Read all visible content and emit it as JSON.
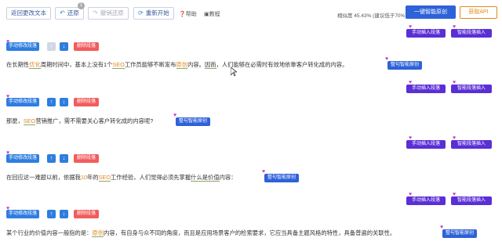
{
  "toolbar": {
    "return_label": "返回更改文本",
    "undo_label": "还原",
    "undo_badge": "1",
    "redo_label": "撤销还原",
    "restart_label": "重新开始",
    "help_label": "帮助",
    "tutorial_label": "教程",
    "similarity_text": "相似度 45.43% (建议低于70%)",
    "smart_all_label": "一键智能原创",
    "api_label": "获取API"
  },
  "blocks": [
    {
      "insert_label": "手动插入段落",
      "smart_insert_label": "智能段落插入",
      "edit_label": "手动修改段落",
      "delete_label": "删除段落",
      "segments": [
        {
          "t": "在长期性",
          "c": ""
        },
        {
          "t": "优化",
          "c": "hl ul"
        },
        {
          "t": "周期时间中，基本上没有1个",
          "c": ""
        },
        {
          "t": "SEO",
          "c": "hl ul"
        },
        {
          "t": "工作员能够不断发布",
          "c": ""
        },
        {
          "t": "原创",
          "c": "hl ul"
        },
        {
          "t": "内容。",
          "c": ""
        },
        {
          "t": "因而",
          "c": "ul"
        },
        {
          "t": "，人们能够在必需时有效地依靠客户转化成的内容。",
          "c": ""
        }
      ],
      "smart_sentence_label": "整句智能原创"
    },
    {
      "insert_label": "手动插入段落",
      "smart_insert_label": "智能段落插入",
      "edit_label": "手动修改段落",
      "delete_label": "删除段落",
      "segments": [
        {
          "t": "那麼，",
          "c": ""
        },
        {
          "t": "SEO",
          "c": "hl ul"
        },
        {
          "t": "营销推广，需不需要关心客户转化成的内容呢?",
          "c": ""
        }
      ],
      "smart_sentence_label": "整句智能原创"
    },
    {
      "insert_label": "手动插入段落",
      "smart_insert_label": "智能段落插入",
      "edit_label": "手动修改段落",
      "delete_label": "删除段落",
      "segments": [
        {
          "t": "在回应这一难题以前，依据我",
          "c": ""
        },
        {
          "t": "10",
          "c": "hl"
        },
        {
          "t": "年的",
          "c": ""
        },
        {
          "t": "SEO",
          "c": "hl ul"
        },
        {
          "t": "工作经验，人们觉得必须先掌握",
          "c": ""
        },
        {
          "t": "什么是价值",
          "c": "ul"
        },
        {
          "t": "内容：",
          "c": ""
        }
      ],
      "smart_sentence_label": "整句智能原创"
    },
    {
      "insert_label": "手动插入段落",
      "smart_insert_label": "智能段落插入",
      "edit_label": "手动修改段落",
      "delete_label": "删除段落",
      "segments": [
        {
          "t": "某个行业的价值内容一般指的是：",
          "c": ""
        },
        {
          "t": "原创",
          "c": "hl ul"
        },
        {
          "t": "内容，有自身与众不同的角度，而且是应用场景客户的检索要求，它应当具备主题风格的特性，具备普遍的关联性。",
          "c": ""
        }
      ],
      "smart_sentence_label": "整句智能原创"
    }
  ],
  "colors": {
    "accent": "#2e62d9",
    "purple": "#5a2fd6",
    "danger": "#f25c5c",
    "highlight": "#e08a1e"
  },
  "icons": {
    "undo": "undo-icon",
    "redo": "redo-icon",
    "restart": "refresh-icon",
    "help": "help-icon",
    "tutorial": "video-icon",
    "insert": "heart-icon"
  }
}
